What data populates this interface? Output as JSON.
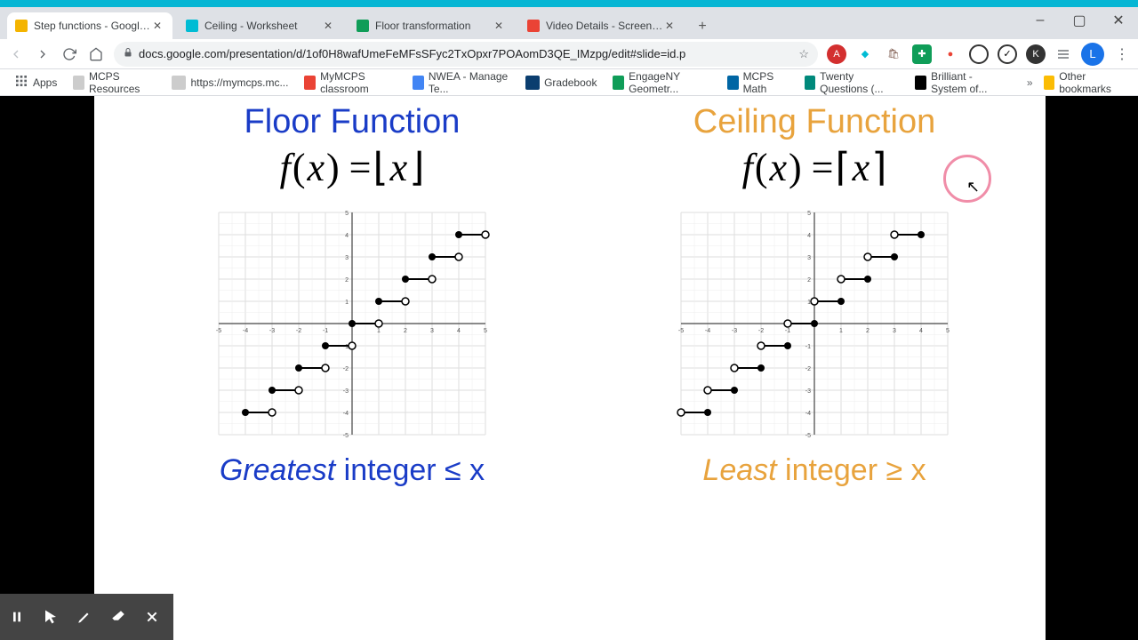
{
  "window": {
    "minimize": "–",
    "maximize": "▢",
    "close": "✕"
  },
  "tabs": [
    {
      "label": "Step functions - Google Slides",
      "active": true,
      "icon": "slides"
    },
    {
      "label": "Ceiling - Worksheet",
      "active": false,
      "icon": "ceiling"
    },
    {
      "label": "Floor transformation",
      "active": false,
      "icon": "floor"
    },
    {
      "label": "Video Details - Screencastify",
      "active": false,
      "icon": "castify"
    }
  ],
  "url": "docs.google.com/presentation/d/1of0H8wafUmeFeMFsSFyc2TxOpxr7POAomD3QE_IMzpg/edit#slide=id.p",
  "bookmarks": [
    {
      "label": "Apps",
      "ico": "grid"
    },
    {
      "label": "MCPS Resources",
      "ico": "doc"
    },
    {
      "label": "https://mymcps.mc...",
      "ico": "doc"
    },
    {
      "label": "MyMCPS classroom",
      "ico": "red"
    },
    {
      "label": "NWEA - Manage Te...",
      "ico": "blue"
    },
    {
      "label": "Gradebook",
      "ico": "w"
    },
    {
      "label": "EngageNY Geometr...",
      "ico": "green"
    },
    {
      "label": "MCPS Math",
      "ico": "mc"
    },
    {
      "label": "Twenty Questions (...",
      "ico": "teal"
    },
    {
      "label": "Brilliant - System of...",
      "ico": "br"
    }
  ],
  "other_bookmarks": "Other bookmarks",
  "avatar": "L",
  "slide": {
    "left": {
      "title": "Floor Function",
      "formula_f": "f",
      "formula_x": "x",
      "caption_ital": "Greatest",
      "caption_plain": " integer ≤ x"
    },
    "right": {
      "title": "Ceiling Function",
      "formula_f": "f",
      "formula_x": "x",
      "caption_ital": "Least",
      "caption_plain": " integer ≥ x"
    }
  },
  "chart_data": [
    {
      "type": "step",
      "title": "Floor Function",
      "function": "floor(x)",
      "xlim": [
        -5,
        5
      ],
      "ylim": [
        -5,
        5
      ],
      "segments": [
        {
          "x_from": -4,
          "x_to": -3,
          "y": -4,
          "closed_left": true,
          "closed_right": false
        },
        {
          "x_from": -3,
          "x_to": -2,
          "y": -3,
          "closed_left": true,
          "closed_right": false
        },
        {
          "x_from": -2,
          "x_to": -1,
          "y": -2,
          "closed_left": true,
          "closed_right": false
        },
        {
          "x_from": -1,
          "x_to": 0,
          "y": -1,
          "closed_left": true,
          "closed_right": false
        },
        {
          "x_from": 0,
          "x_to": 1,
          "y": 0,
          "closed_left": true,
          "closed_right": false
        },
        {
          "x_from": 1,
          "x_to": 2,
          "y": 1,
          "closed_left": true,
          "closed_right": false
        },
        {
          "x_from": 2,
          "x_to": 3,
          "y": 2,
          "closed_left": true,
          "closed_right": false
        },
        {
          "x_from": 3,
          "x_to": 4,
          "y": 3,
          "closed_left": true,
          "closed_right": false
        },
        {
          "x_from": 4,
          "x_to": 5,
          "y": 4,
          "closed_left": true,
          "closed_right": false
        }
      ]
    },
    {
      "type": "step",
      "title": "Ceiling Function",
      "function": "ceil(x)",
      "xlim": [
        -5,
        5
      ],
      "ylim": [
        -5,
        5
      ],
      "segments": [
        {
          "x_from": -5,
          "x_to": -4,
          "y": -4,
          "closed_left": false,
          "closed_right": true
        },
        {
          "x_from": -4,
          "x_to": -3,
          "y": -3,
          "closed_left": false,
          "closed_right": true
        },
        {
          "x_from": -3,
          "x_to": -2,
          "y": -2,
          "closed_left": false,
          "closed_right": true
        },
        {
          "x_from": -2,
          "x_to": -1,
          "y": -1,
          "closed_left": false,
          "closed_right": true
        },
        {
          "x_from": -1,
          "x_to": 0,
          "y": 0,
          "closed_left": false,
          "closed_right": true
        },
        {
          "x_from": 0,
          "x_to": 1,
          "y": 1,
          "closed_left": false,
          "closed_right": true
        },
        {
          "x_from": 1,
          "x_to": 2,
          "y": 2,
          "closed_left": false,
          "closed_right": true
        },
        {
          "x_from": 2,
          "x_to": 3,
          "y": 3,
          "closed_left": false,
          "closed_right": true
        },
        {
          "x_from": 3,
          "x_to": 4,
          "y": 4,
          "closed_left": false,
          "closed_right": true
        }
      ]
    }
  ]
}
